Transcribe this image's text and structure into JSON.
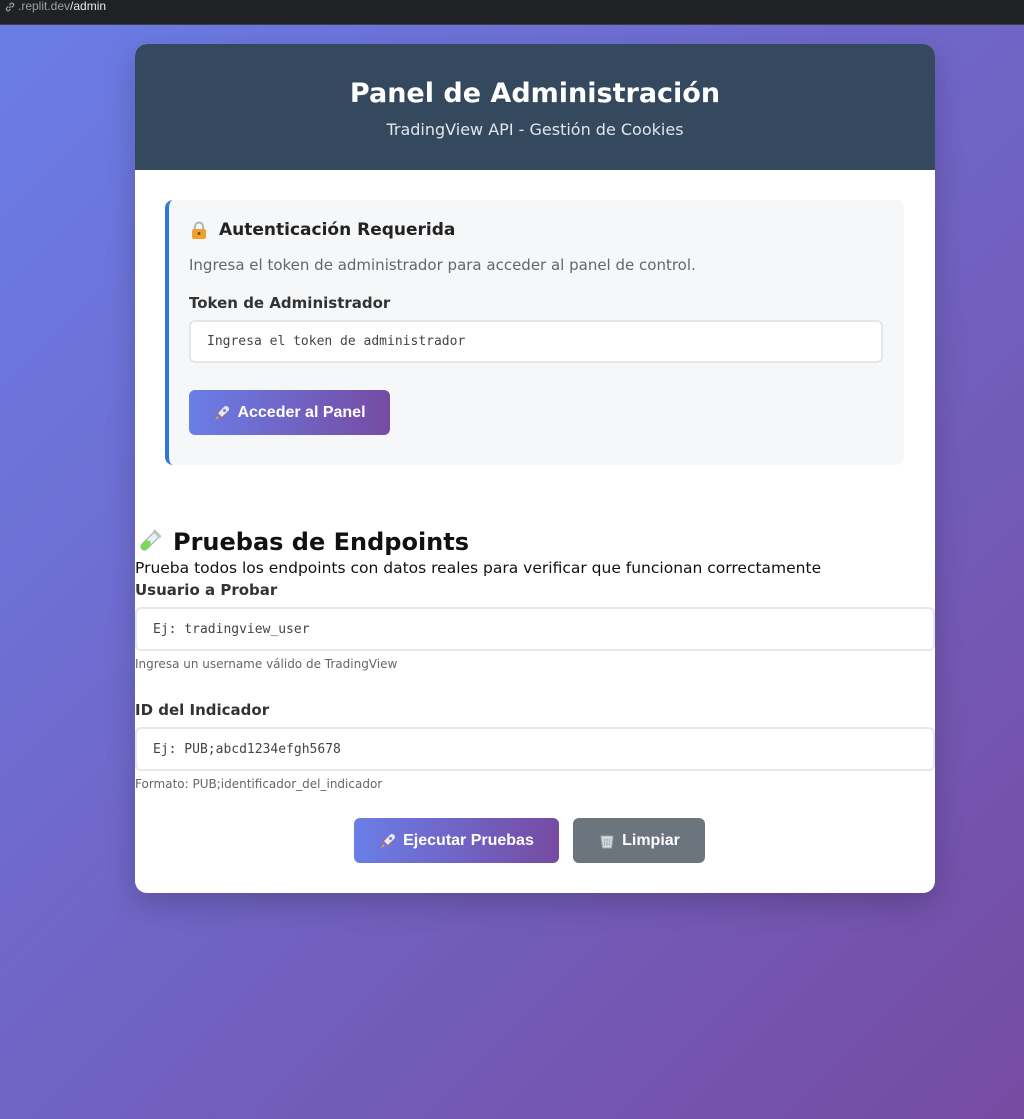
{
  "browser": {
    "url_host": ".replit.dev",
    "url_path": "/admin"
  },
  "header": {
    "title": "Panel de Administración",
    "subtitle": "TradingView API - Gestión de Cookies"
  },
  "auth": {
    "title": "Autenticación Requerida",
    "description": "Ingresa el token de administrador para acceder al panel de control.",
    "token_label": "Token de Administrador",
    "token_placeholder": "Ingresa el token de administrador",
    "access_button": "Acceder al Panel",
    "icon": "lock-icon"
  },
  "tests": {
    "title": "Pruebas de Endpoints",
    "description": "Prueba todos los endpoints con datos reales para verificar que funcionan correctamente",
    "icon": "test-tube-icon",
    "user_label": "Usuario a Probar",
    "user_placeholder": "Ej: tradingview_user",
    "user_hint": "Ingresa un username válido de TradingView",
    "indicator_label": "ID del Indicador",
    "indicator_placeholder": "Ej: PUB;abcd1234efgh5678",
    "indicator_hint": "Formato: PUB;identificador_del_indicador",
    "run_button": "Ejecutar Pruebas",
    "clear_button": "Limpiar"
  },
  "colors": {
    "background_start": "#6a7ee8",
    "background_end": "#764ba2",
    "header_bg": "#34495e",
    "accent_border": "#2d7ad6",
    "clear_button_bg": "#6c757d"
  }
}
